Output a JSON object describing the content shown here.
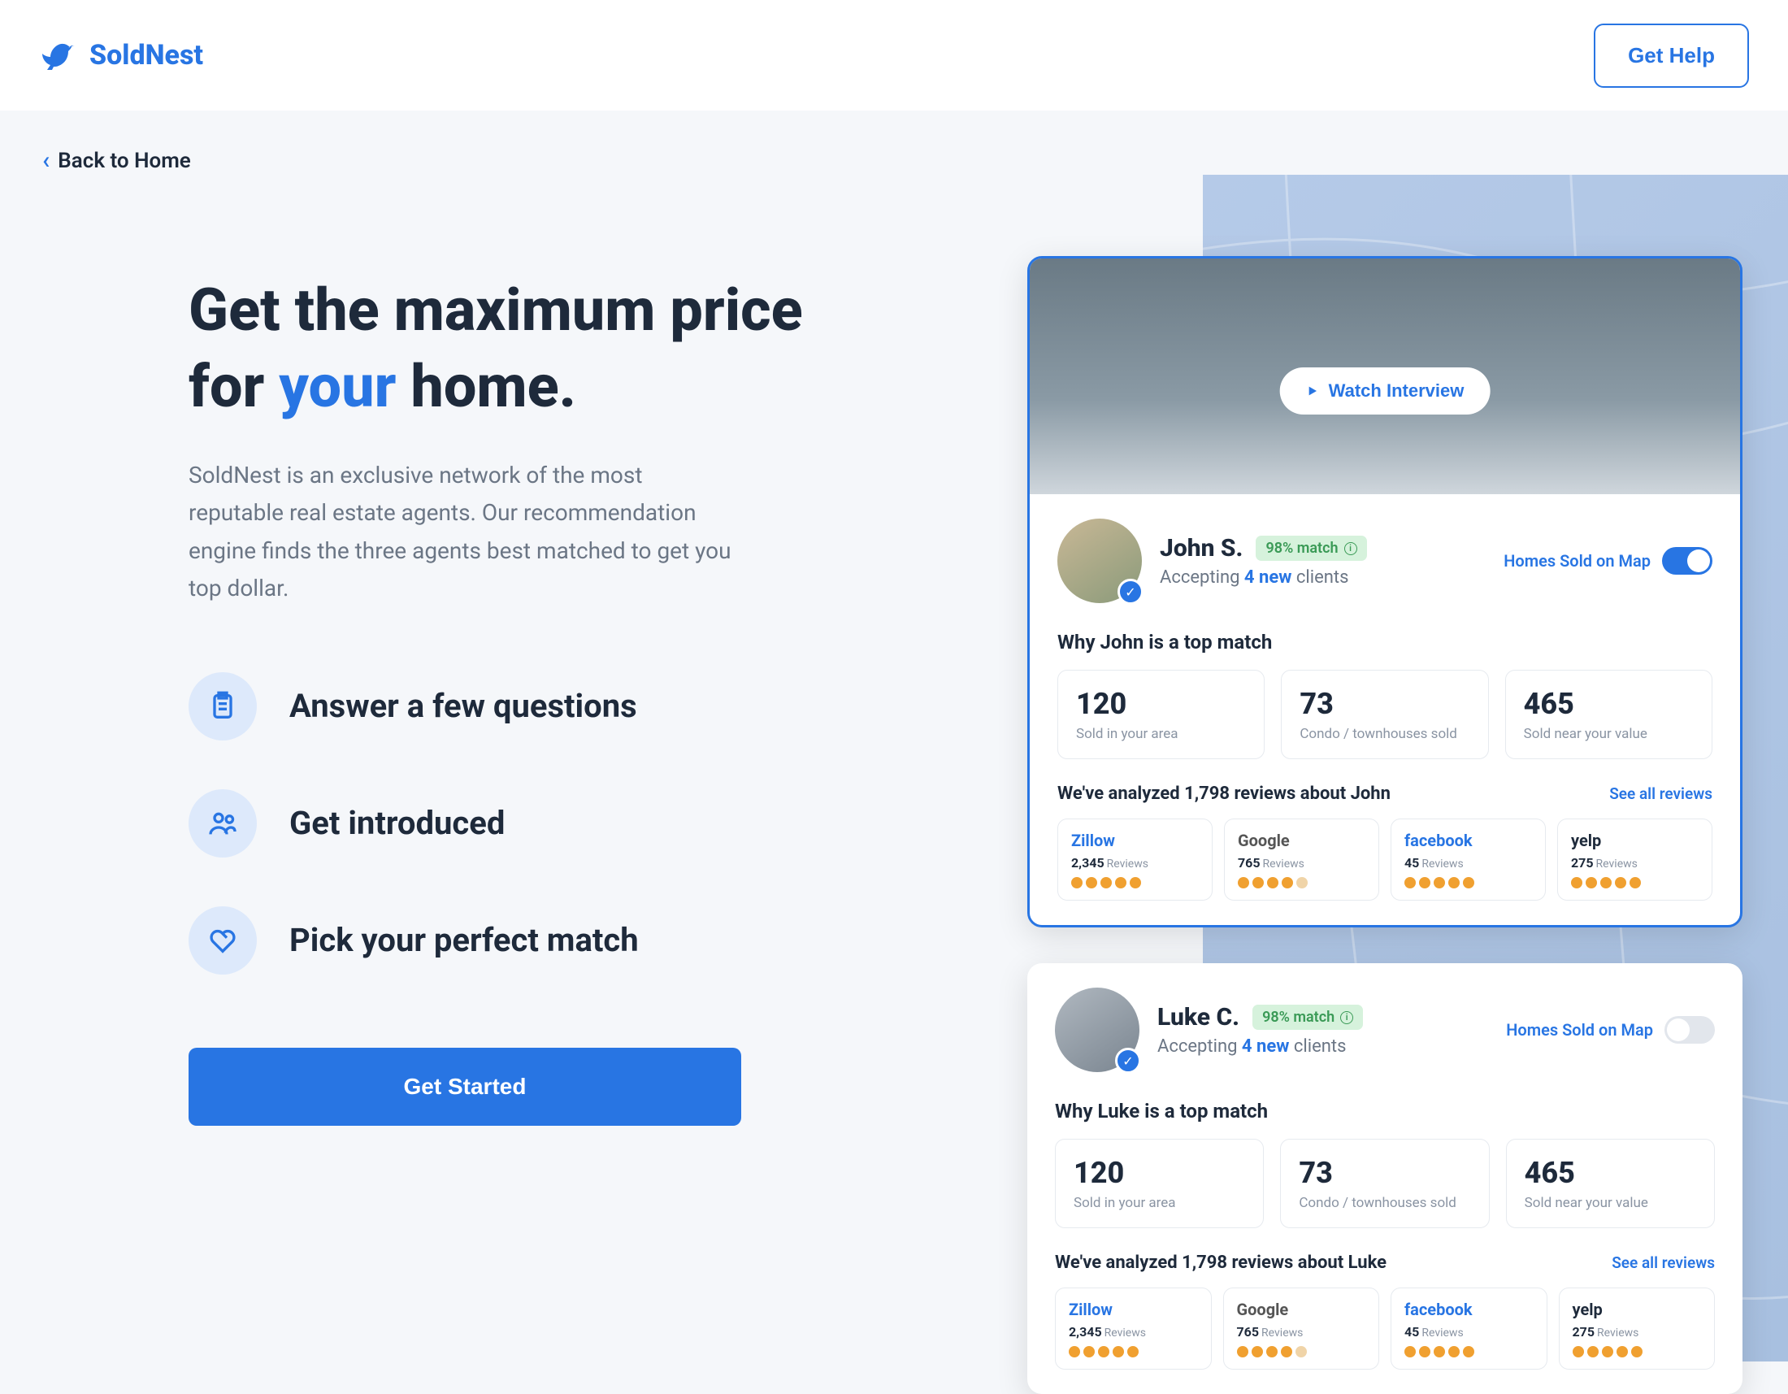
{
  "header": {
    "brand": "SoldNest",
    "get_help": "Get Help"
  },
  "back_link": "Back to Home",
  "hero": {
    "headline_pre": "Get the maximum price for ",
    "headline_accent": "your",
    "headline_post": " home.",
    "subtext": "SoldNest is an exclusive network of the most reputable real estate agents. Our recommendation engine finds the three agents best matched to get you top dollar."
  },
  "steps": [
    "Answer a few questions",
    "Get introduced",
    "Pick your perfect match"
  ],
  "cta": "Get Started",
  "watch_interview": "Watch Interview",
  "map_toggle_label": "Homes Sold on Map",
  "see_all_reviews": "See all reviews",
  "agents": [
    {
      "name": "John S.",
      "match": "98% match",
      "accepting_pre": "Accepting ",
      "accepting_num": "4 new",
      "accepting_post": " clients",
      "toggle_on": true,
      "why_title": "Why John is a top match",
      "stats": [
        {
          "val": "120",
          "label": "Sold in your area"
        },
        {
          "val": "73",
          "label": "Condo / townhouses sold"
        },
        {
          "val": "465",
          "label": "Sold near your value"
        }
      ],
      "reviews_title": "We've analyzed 1,798 reviews about John",
      "reviews": [
        {
          "source": "Zillow",
          "count": "2,345",
          "cls": "src-zillow",
          "dim": 0
        },
        {
          "source": "Google",
          "count": "765",
          "cls": "src-google",
          "dim": 1
        },
        {
          "source": "facebook",
          "count": "45",
          "cls": "src-facebook",
          "dim": 0
        },
        {
          "source": "yelp",
          "count": "275",
          "cls": "src-yelp",
          "dim": 0
        }
      ]
    },
    {
      "name": "Luke C.",
      "match": "98% match",
      "accepting_pre": "Accepting ",
      "accepting_num": "4 new",
      "accepting_post": " clients",
      "toggle_on": false,
      "why_title": "Why Luke is a top match",
      "stats": [
        {
          "val": "120",
          "label": "Sold in your area"
        },
        {
          "val": "73",
          "label": "Condo / townhouses sold"
        },
        {
          "val": "465",
          "label": "Sold near your value"
        }
      ],
      "reviews_title": "We've analyzed 1,798 reviews about Luke",
      "reviews": [
        {
          "source": "Zillow",
          "count": "2,345",
          "cls": "src-zillow",
          "dim": 0
        },
        {
          "source": "Google",
          "count": "765",
          "cls": "src-google",
          "dim": 1
        },
        {
          "source": "facebook",
          "count": "45",
          "cls": "src-facebook",
          "dim": 0
        },
        {
          "source": "yelp",
          "count": "275",
          "cls": "src-yelp",
          "dim": 0
        }
      ]
    }
  ],
  "reviews_label": "Reviews"
}
